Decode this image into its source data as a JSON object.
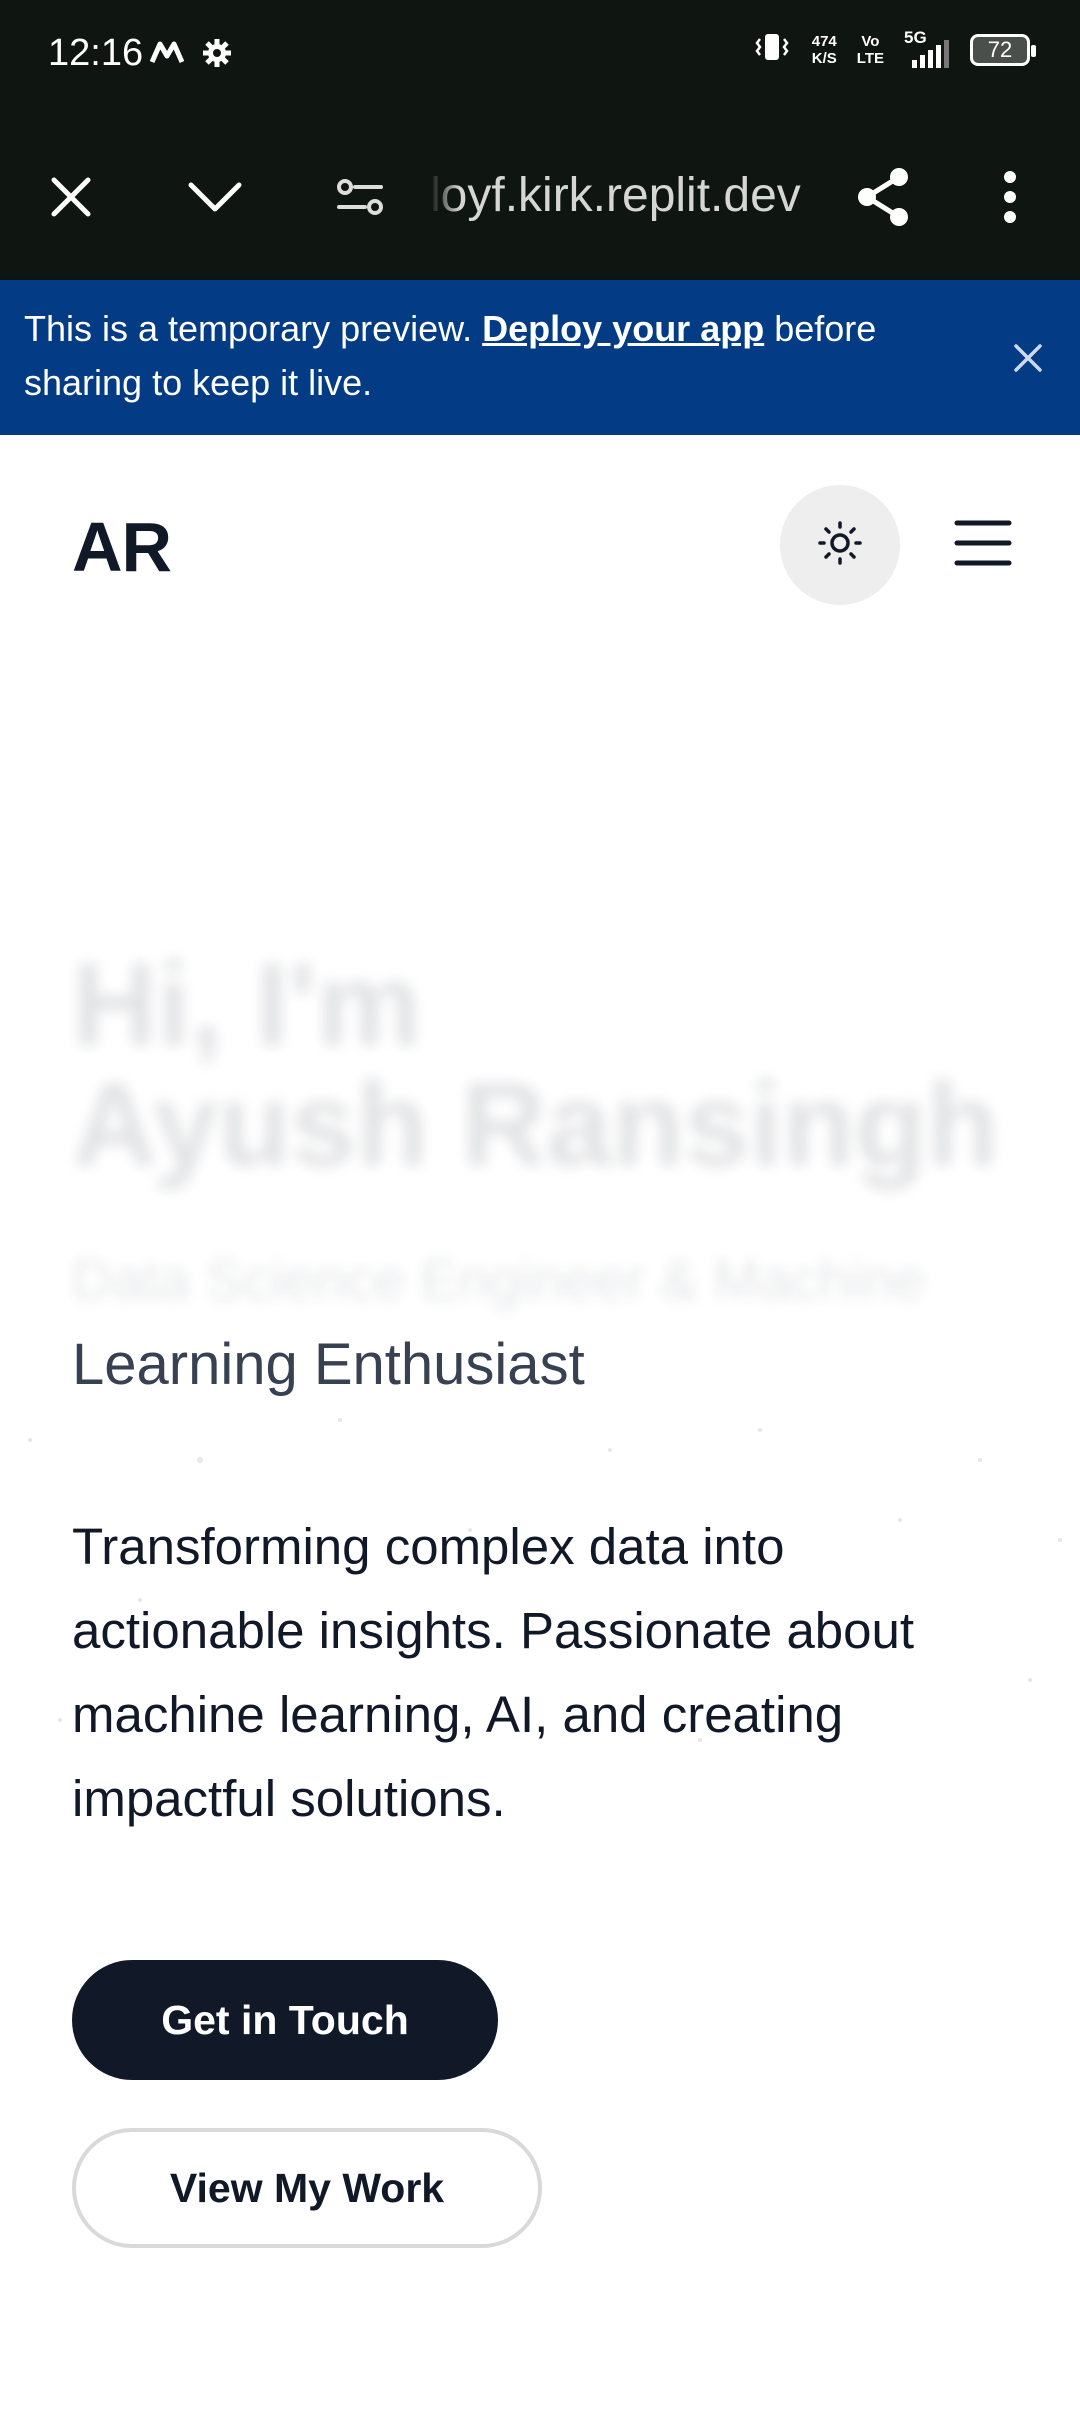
{
  "status_bar": {
    "time": "12:16",
    "network_speed_value": "474",
    "network_speed_unit": "K/S",
    "volte_top": "Vo",
    "volte_bottom": "LTE",
    "signal_label": "5G",
    "battery_level": "72",
    "icons": [
      "m-app-icon",
      "gear-icon",
      "vibrate-icon",
      "signal-icon",
      "battery-icon"
    ]
  },
  "browser": {
    "url": "loyf.kirk.replit.dev",
    "icons": [
      "close-icon",
      "chevron-down-icon",
      "site-settings-icon",
      "share-icon",
      "more-vert-icon"
    ]
  },
  "banner": {
    "text_before": "This is a temporary preview. ",
    "link_text": "Deploy your app",
    "text_after": " before sharing to keep it live.",
    "background": "#033b85"
  },
  "header": {
    "logo": "AR",
    "theme_icon": "sun-icon",
    "menu_icon": "hamburger-icon"
  },
  "hero": {
    "greeting_line1": "Hi, I'm",
    "greeting_line2": "Ayush Ransingh",
    "role_line1": "Data Science Engineer & Machine",
    "role_line2": "Learning Enthusiast",
    "description": "Transforming complex data into actionable insights. Passionate about machine learning, AI, and creating impactful solutions.",
    "primary_button": "Get in Touch",
    "secondary_button": "View My Work",
    "accent_dark": "#111827"
  }
}
